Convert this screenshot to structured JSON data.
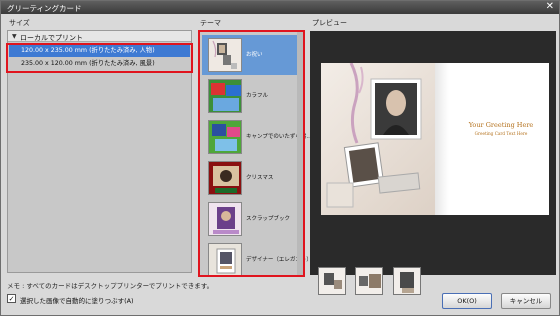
{
  "window": {
    "title": "グリーティングカード",
    "close_glyph": "✕"
  },
  "headers": {
    "size": "サイズ",
    "theme": "テーマ",
    "preview": "プレビュー"
  },
  "size_panel": {
    "group_label": "ローカルでプリント",
    "group_icon": "triangle-down-icon",
    "options": [
      {
        "label": "120.00 x 235.00 mm (折りたたみ済み, 人物)",
        "selected": true
      },
      {
        "label": "235.00 x 120.00 mm (折りたたみ済み, 風景)",
        "selected": false
      }
    ]
  },
  "themes": [
    {
      "name": "お祝い",
      "selected": true
    },
    {
      "name": "カラフル",
      "selected": false
    },
    {
      "name": "キャンプでのいたずら書...",
      "selected": false
    },
    {
      "name": "クリスマス",
      "selected": false
    },
    {
      "name": "スクラップブック",
      "selected": false
    },
    {
      "name": "デザイナー（エレガント）",
      "selected": false
    }
  ],
  "preview": {
    "greeting_title": "Your Greeting Here",
    "greeting_sub": "Greeting Card Text Here"
  },
  "footer": {
    "note": "メモ : すべてのカードはデスクトッププリンターでプリントできます。",
    "autofill_checked": true,
    "autofill_label": "選択した画像で自動的に塗りつぶす(A)",
    "ok_label": "OK(O)",
    "cancel_label": "キャンセル"
  },
  "colors": {
    "highlight": "#e0141e",
    "selection": "#3e7ad3",
    "title_text": "#b5731f"
  }
}
